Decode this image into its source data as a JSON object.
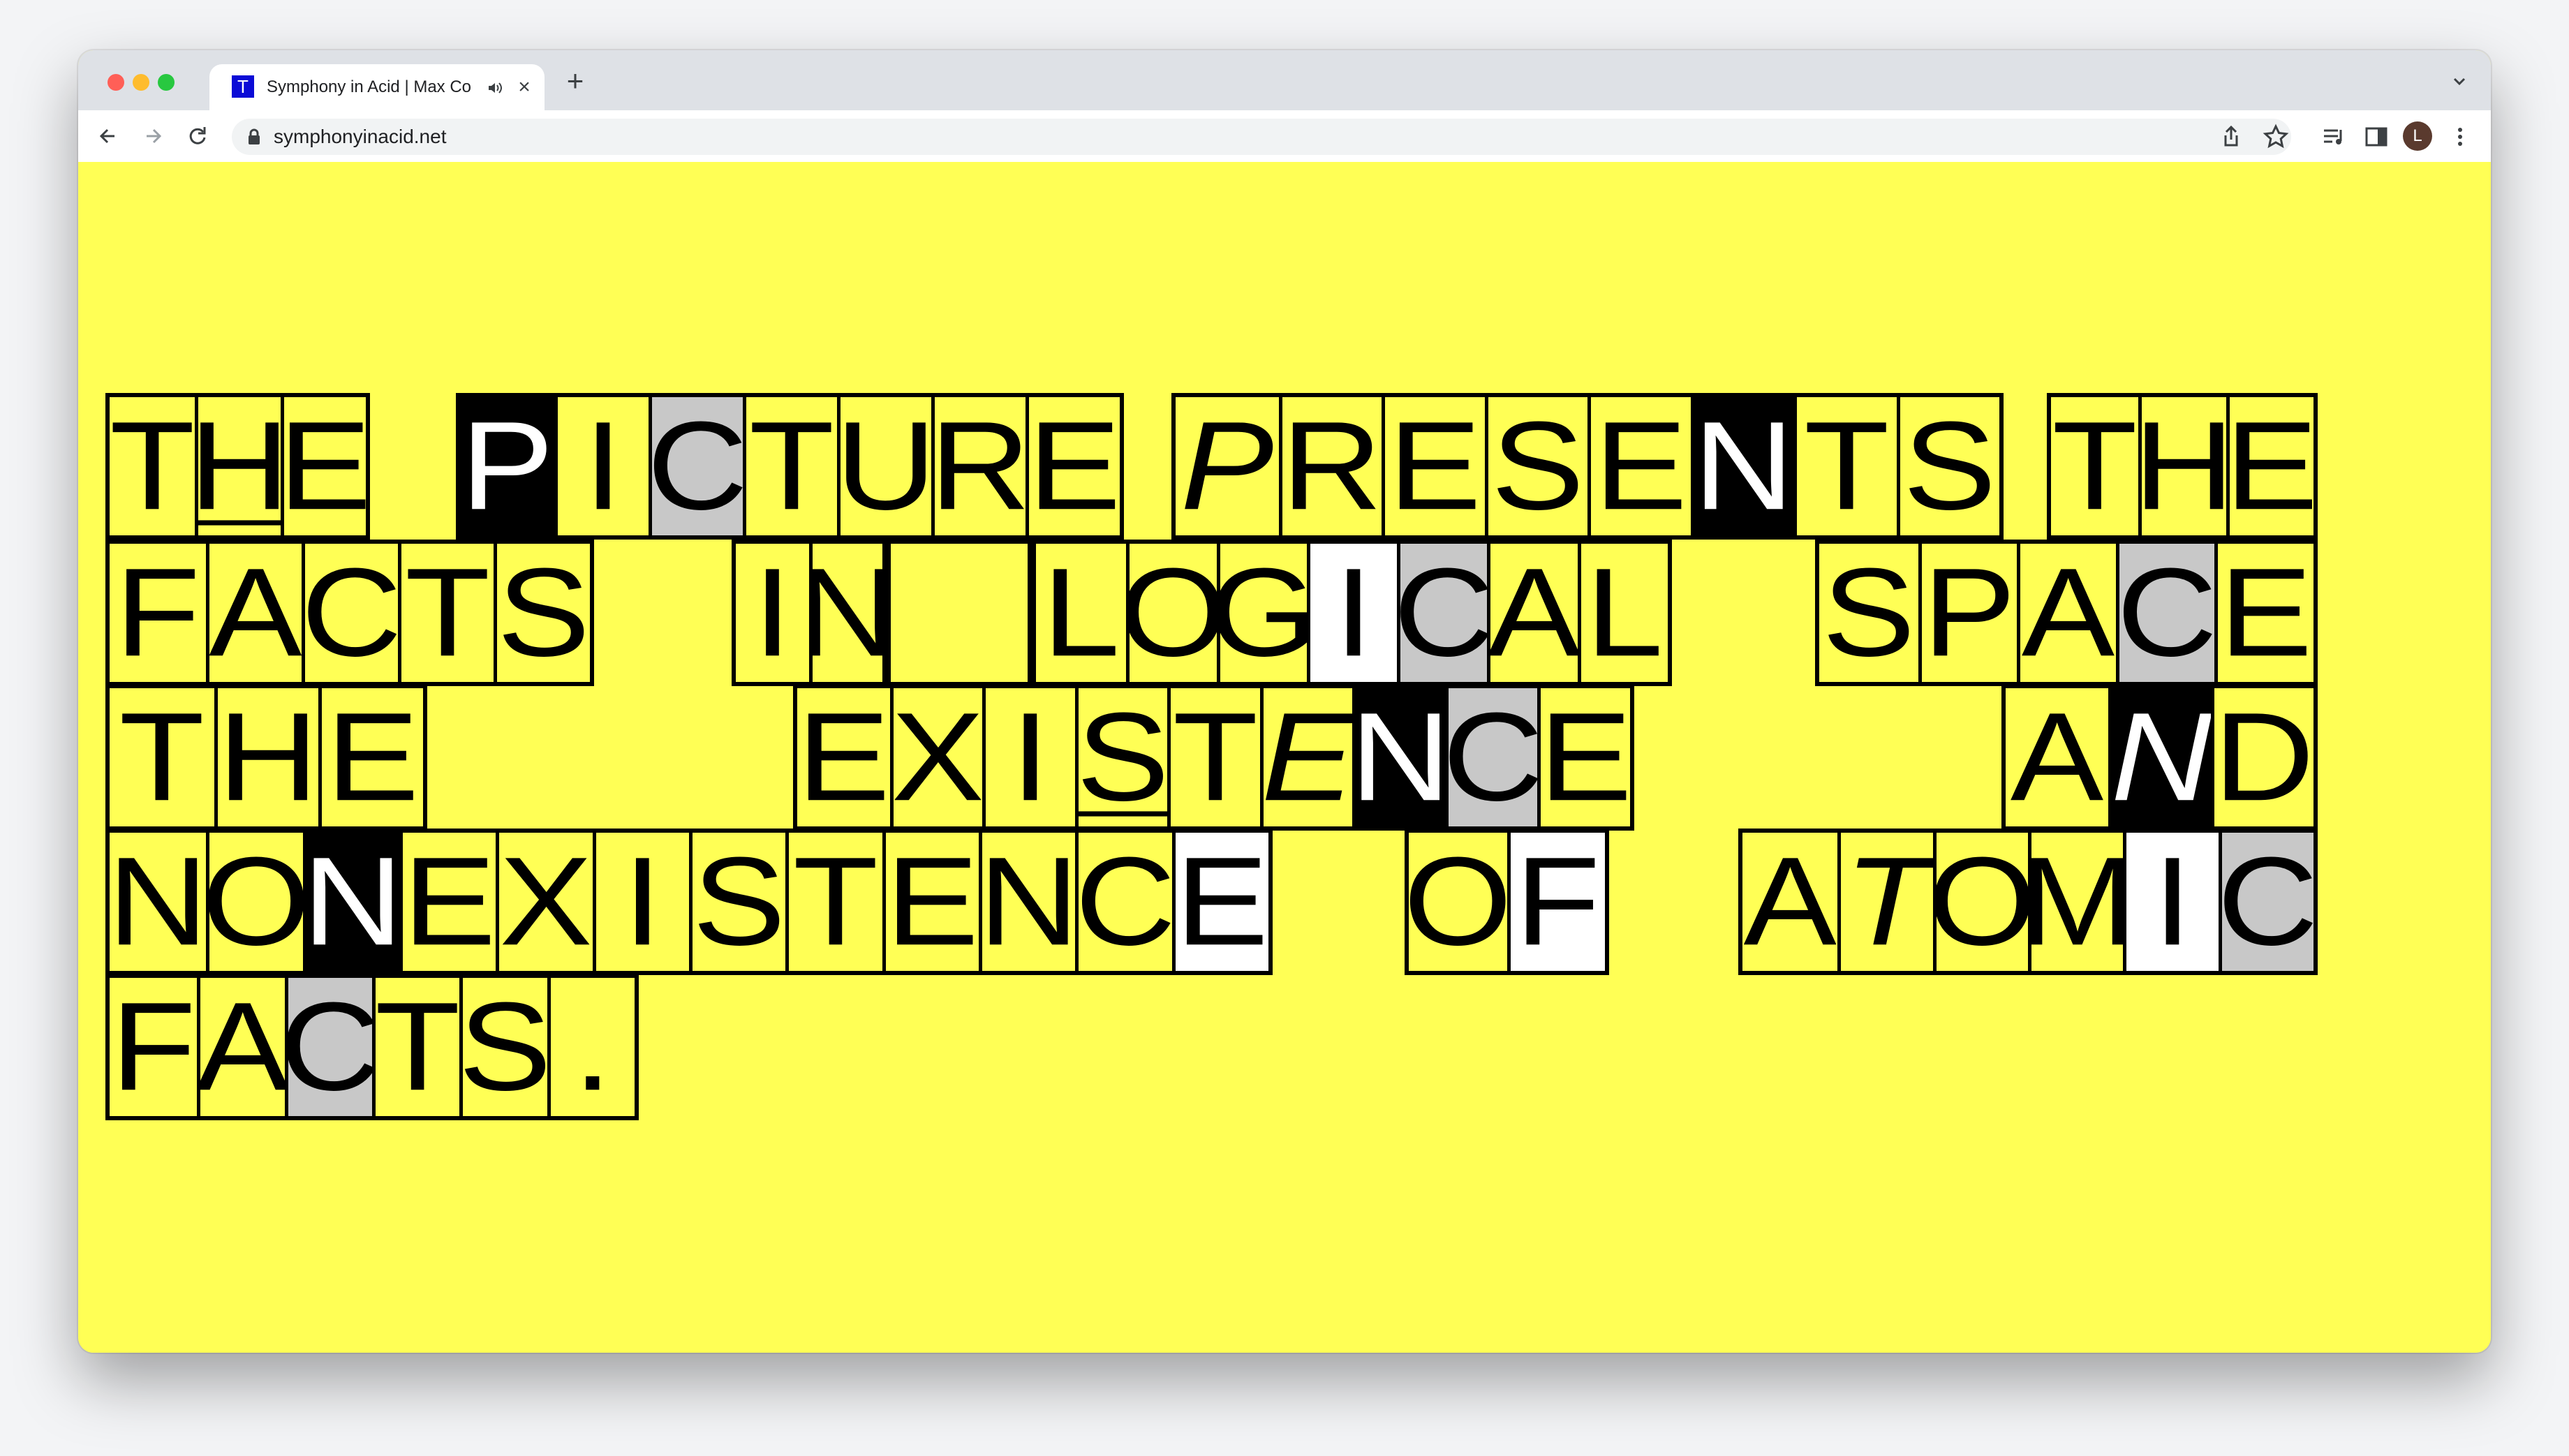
{
  "browser": {
    "tab_title": "Symphony in Acid | Max Co",
    "favicon_letter": "T",
    "new_tab_label": "+",
    "close_label": "×",
    "url": "symphonyinacid.net",
    "avatar_letter": "L"
  },
  "rows": [
    [
      {
        "text": "THE",
        "styles": [
          "",
          "u",
          ""
        ]
      },
      {
        "text": "PICTURE",
        "styles": [
          "k",
          "",
          "g",
          "",
          "",
          "",
          ""
        ]
      },
      {
        "text": "PRESENTS",
        "styles": [
          "i",
          "",
          "",
          "",
          "",
          "k",
          "",
          ""
        ]
      },
      {
        "text": "THE",
        "styles": [
          "",
          "",
          ""
        ]
      }
    ],
    [
      {
        "text": "FACTS",
        "styles": [
          "",
          "",
          "",
          "",
          ""
        ]
      },
      {
        "text": "IN",
        "styles": [
          "",
          ""
        ]
      },
      {
        "text": "",
        "styles": []
      },
      {
        "text": "LOGICAL",
        "styles": [
          "",
          "",
          "",
          "w",
          "g",
          "",
          ""
        ]
      },
      {
        "text": "SPACE",
        "styles": [
          "",
          "",
          "",
          "g",
          ""
        ]
      }
    ],
    [
      {
        "text": "THE",
        "styles": [
          "",
          "",
          ""
        ]
      },
      {
        "text": "EXISTENCE",
        "styles": [
          "",
          "",
          "",
          "u",
          "",
          "i",
          "k",
          "g",
          ""
        ]
      },
      {
        "text": "AND",
        "styles": [
          "",
          "ik",
          ""
        ]
      }
    ],
    [
      {
        "text": "NONEXISTENCE",
        "styles": [
          "",
          "",
          "k",
          "",
          "",
          "",
          "",
          "",
          "",
          "",
          "",
          "w"
        ]
      },
      {
        "text": "OF",
        "styles": [
          "",
          "w"
        ]
      },
      {
        "text": "ATOMIC",
        "styles": [
          "",
          "i",
          "",
          "",
          "w",
          "g"
        ]
      }
    ],
    [
      {
        "text": "FACTS.",
        "styles": [
          "",
          "",
          "g",
          "",
          "",
          ""
        ]
      }
    ]
  ]
}
